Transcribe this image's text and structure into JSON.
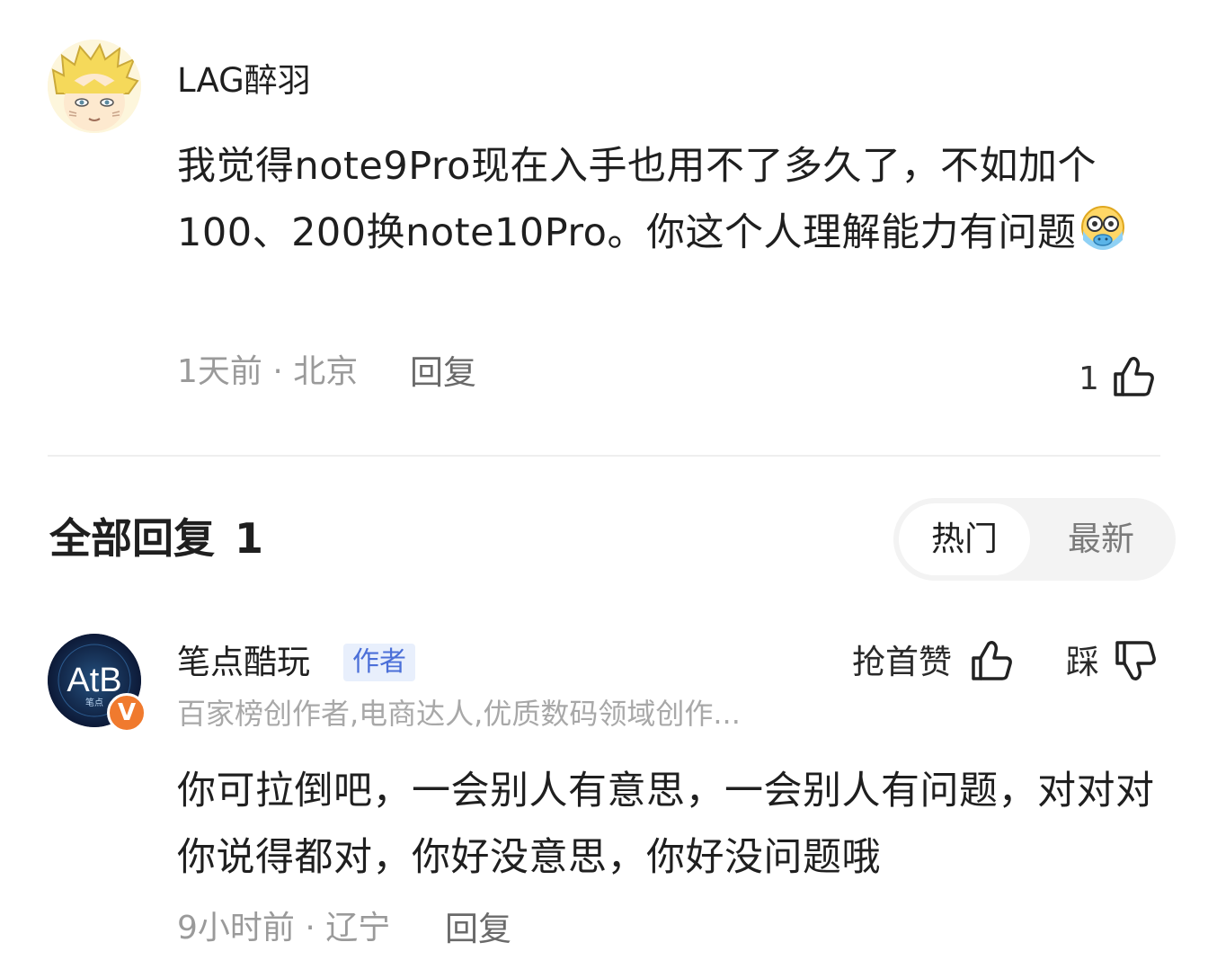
{
  "comment": {
    "username": "LAG醉羽",
    "text": "我觉得note9Pro现在入手也用不了多久了，不如加个100、200换note10Pro。你这个人理解能力有问题",
    "emoji": "scared-face-emoji",
    "time_location": "1天前 · 北京",
    "reply_label": "回复",
    "like_count": "1",
    "avatar": "anime-blond-avatar"
  },
  "replies_section": {
    "title": "全部回复",
    "count": "1",
    "sort_options": [
      "热门",
      "最新"
    ],
    "active_sort": "热门"
  },
  "reply": {
    "username": "笔点酷玩",
    "badge": "作者",
    "subtitle": "百家榜创作者,电商达人,优质数码领域创作...",
    "avatar_text": "AtB",
    "avatar_sub_text": "笔点",
    "verified_mark": "V",
    "grab_like_label": "抢首赞",
    "dislike_label": "踩",
    "text": "你可拉倒吧，一会别人有意思，一会别人有问题，对对对你说得都对，你好没意思，你好没问题哦",
    "time_location": "9小时前 · 辽宁",
    "reply_label": "回复"
  },
  "colors": {
    "badge_bg": "#e8effc",
    "badge_text": "#4b6fd8",
    "verified": "#f07a2e"
  }
}
